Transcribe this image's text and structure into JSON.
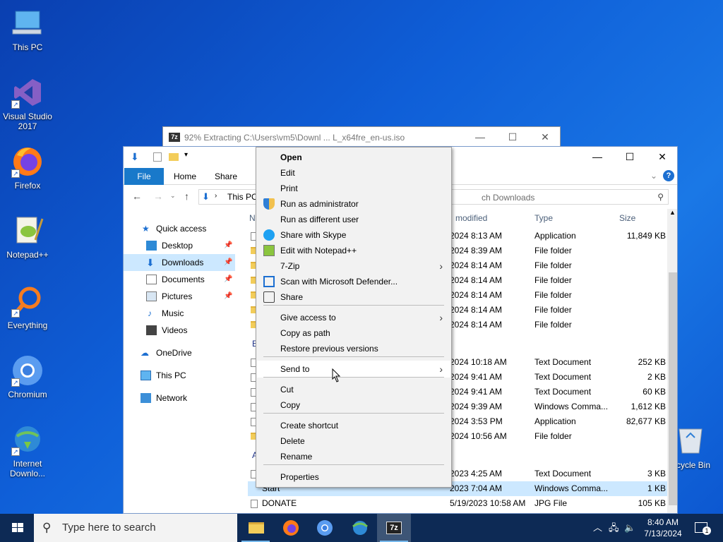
{
  "desktop": {
    "icons": [
      {
        "label": "This PC"
      },
      {
        "label": "Visual Studio 2017"
      },
      {
        "label": "Firefox"
      },
      {
        "label": "Notepad++"
      },
      {
        "label": "Everything"
      },
      {
        "label": "Chromium"
      },
      {
        "label": "Internet Downlo..."
      }
    ],
    "recycle_bin_label": "cycle Bin"
  },
  "zip_window": {
    "logo": "7z",
    "title": "92% Extracting C:\\Users\\vm5\\Downl ... L_x64fre_en-us.iso"
  },
  "explorer": {
    "ribbon_tabs": [
      "File",
      "Home",
      "Share"
    ],
    "address": "This PC",
    "search_placeholder": "ch Downloads",
    "columns": {
      "name": "N",
      "date": "modified",
      "type": "Type",
      "size": "Size"
    },
    "nav": [
      {
        "label": "Quick access"
      },
      {
        "label": "Desktop"
      },
      {
        "label": "Downloads"
      },
      {
        "label": "Documents"
      },
      {
        "label": "Pictures"
      },
      {
        "label": "Music"
      },
      {
        "label": "Videos"
      },
      {
        "label": "OneDrive"
      },
      {
        "label": "This PC"
      },
      {
        "label": "Network"
      }
    ],
    "group_labels": [
      "E",
      "A"
    ],
    "rows": [
      {
        "name": "",
        "date": "2024 8:13 AM",
        "type": "Application",
        "size": "11,849 KB"
      },
      {
        "name": "",
        "date": "2024 8:39 AM",
        "type": "File folder",
        "size": ""
      },
      {
        "name": "",
        "date": "2024 8:14 AM",
        "type": "File folder",
        "size": ""
      },
      {
        "name": "",
        "date": "2024 8:14 AM",
        "type": "File folder",
        "size": ""
      },
      {
        "name": "",
        "date": "2024 8:14 AM",
        "type": "File folder",
        "size": ""
      },
      {
        "name": "",
        "date": "2024 8:14 AM",
        "type": "File folder",
        "size": ""
      },
      {
        "name": "",
        "date": "2024 8:14 AM",
        "type": "File folder",
        "size": ""
      },
      {
        "name": "",
        "date": "2024 10:18 AM",
        "type": "Text Document",
        "size": "252 KB"
      },
      {
        "name": "",
        "date": "2024 9:41 AM",
        "type": "Text Document",
        "size": "2 KB"
      },
      {
        "name": "",
        "date": "2024 9:41 AM",
        "type": "Text Document",
        "size": "60 KB"
      },
      {
        "name": "",
        "date": "2024 9:39 AM",
        "type": "Windows Comma...",
        "size": "1,612 KB"
      },
      {
        "name": "",
        "date": "2024 3:53 PM",
        "type": "Application",
        "size": "82,677 KB"
      },
      {
        "name": "",
        "date": "2024 10:56 AM",
        "type": "File folder",
        "size": ""
      },
      {
        "name": "",
        "date": "2023 4:25 AM",
        "type": "Text Document",
        "size": "3 KB"
      },
      {
        "name": "Start",
        "date": "2023 7:04 AM",
        "type": "Windows Comma...",
        "size": "1 KB"
      },
      {
        "name": "DONATE",
        "date": "5/19/2023 10:58 AM",
        "type": "JPG File",
        "size": "105 KB"
      }
    ]
  },
  "context_menu": {
    "items": [
      {
        "label": "Open",
        "bold": true
      },
      {
        "label": "Edit"
      },
      {
        "label": "Print"
      },
      {
        "label": "Run as administrator",
        "icon": "shield-icon"
      },
      {
        "label": "Run as different user"
      },
      {
        "label": "Share with Skype",
        "icon": "skype-icon"
      },
      {
        "label": "Edit with Notepad++",
        "icon": "notepadpp-icon"
      },
      {
        "label": "7-Zip",
        "submenu": true
      },
      {
        "label": "Scan with Microsoft Defender...",
        "icon": "defender-icon"
      },
      {
        "label": "Share",
        "icon": "share-icon"
      },
      {
        "label": "Give access to",
        "submenu": true
      },
      {
        "label": "Copy as path"
      },
      {
        "label": "Restore previous versions"
      },
      {
        "label": "Send to",
        "submenu": true
      },
      {
        "label": "Cut"
      },
      {
        "label": "Copy"
      },
      {
        "label": "Create shortcut"
      },
      {
        "label": "Delete"
      },
      {
        "label": "Rename"
      },
      {
        "label": "Properties"
      }
    ],
    "submenu_arrow": "›"
  },
  "taskbar": {
    "search_placeholder": "Type here to search",
    "time": "8:40 AM",
    "date": "7/13/2024",
    "notification_count": "1"
  },
  "colors": {
    "accent": "#1979ca",
    "selection": "#cce8ff",
    "taskbar": "#0d2a55"
  }
}
